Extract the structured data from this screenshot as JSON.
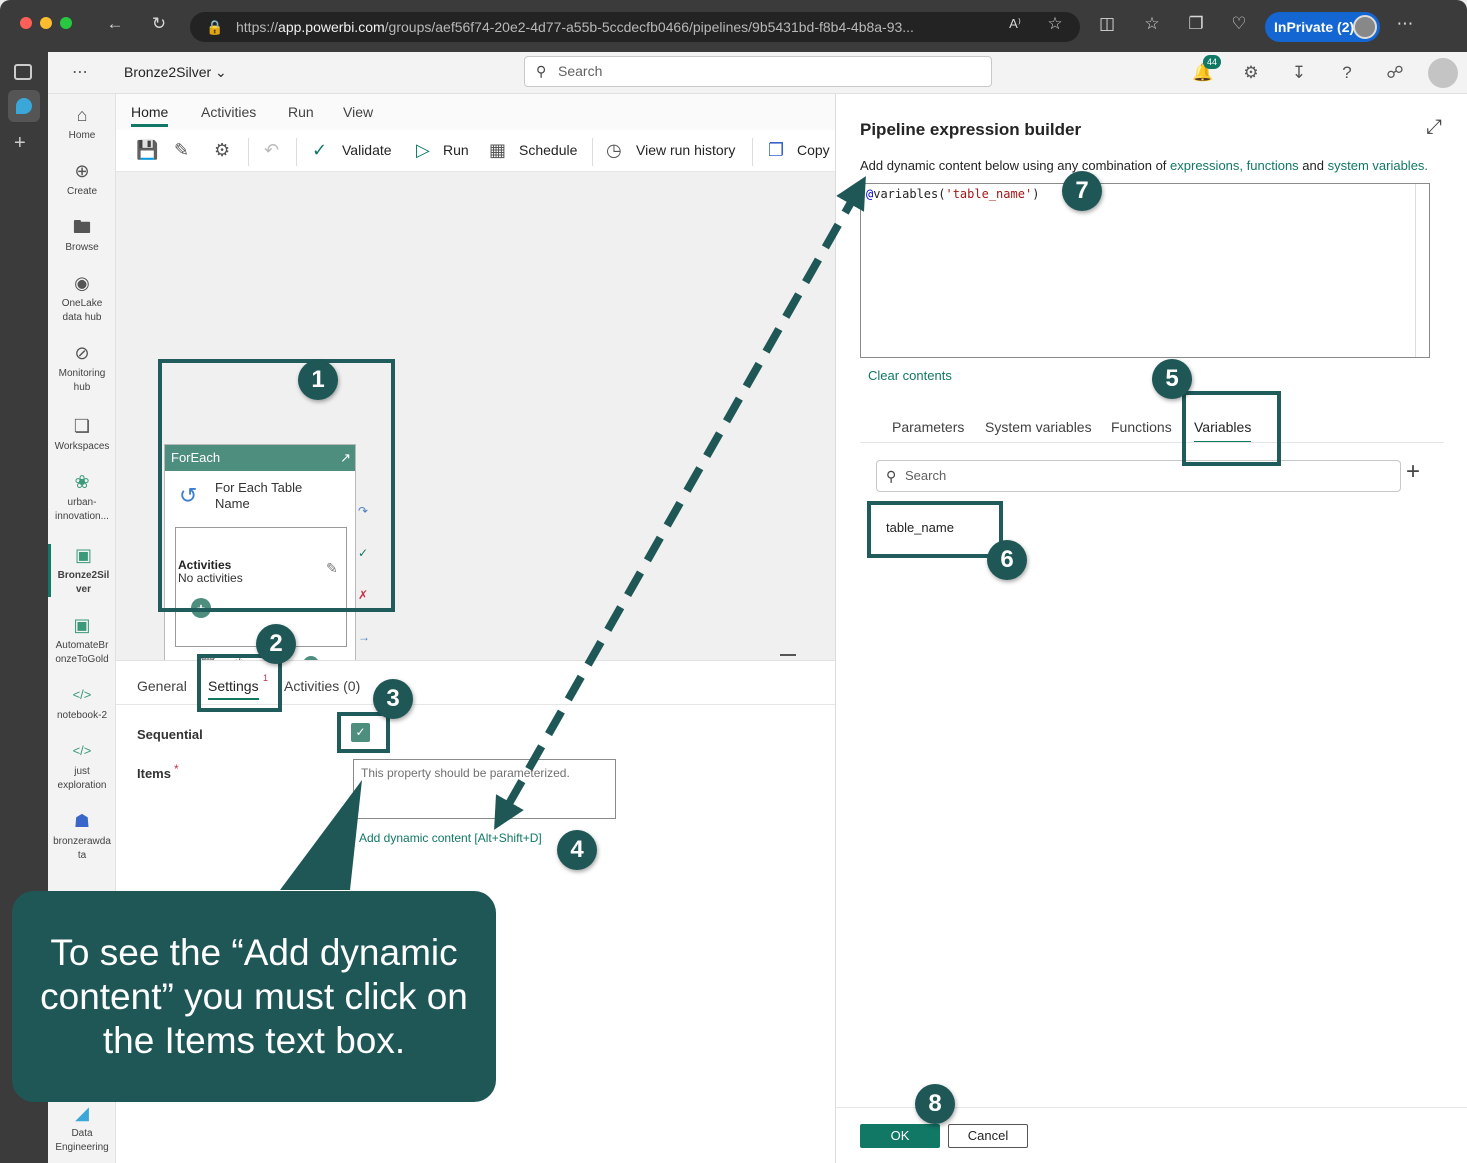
{
  "browser": {
    "url_host": "app.powerbi.com",
    "url_prefix": "https://",
    "url_path": "/groups/aef56f74-20e2-4d77-a55b-5ccdecfb0466/pipelines/9b5431bd-f8b4-4b8a-93...",
    "inprivate_label": "InPrivate (2)"
  },
  "topbar": {
    "workspace": "Bronze2Silver",
    "search_placeholder": "Search",
    "notification_count": "44"
  },
  "leftnav": {
    "items": [
      {
        "label": "Home",
        "icon": "home-icon"
      },
      {
        "label": "Create",
        "icon": "plus-circle-icon"
      },
      {
        "label": "Browse",
        "icon": "folder-icon"
      },
      {
        "label": "OneLake data hub",
        "icon": "onelake-icon"
      },
      {
        "label": "Monitoring hub",
        "icon": "monitor-icon"
      },
      {
        "label": "Workspaces",
        "icon": "workspaces-icon"
      },
      {
        "label": "urban-innovation...",
        "icon": "group-icon"
      },
      {
        "label": "Bronze2Silver",
        "icon": "pipeline-icon"
      },
      {
        "label": "AutomateBronzeToGold",
        "icon": "pipeline-icon"
      },
      {
        "label": "notebook-2",
        "icon": "notebook-icon"
      },
      {
        "label": "just exploration",
        "icon": "notebook-icon"
      },
      {
        "label": "bronzerawdata",
        "icon": "lakehouse-icon"
      },
      {
        "label": "Data Engineering",
        "icon": "data-engineering-icon"
      }
    ]
  },
  "menu": {
    "tabs": [
      "Home",
      "Activities",
      "Run",
      "View"
    ],
    "selected": "Home"
  },
  "ribbon": {
    "validate": "Validate",
    "run": "Run",
    "schedule": "Schedule",
    "view_run_history": "View run history",
    "copy": "Copy"
  },
  "foreach": {
    "header": "ForEach",
    "title": "For Each Table Name",
    "activities_label": "Activities",
    "activities_value": "No activities"
  },
  "bottom": {
    "tabs": [
      "General",
      "Settings",
      "Activities (0)"
    ],
    "settings_badge": "1",
    "sequential_label": "Sequential",
    "items_label": "Items",
    "required_mark": "*",
    "items_placeholder": "This property should be parameterized.",
    "dynamic_link": "Add dynamic content [Alt+Shift+D]"
  },
  "panel": {
    "title": "Pipeline expression builder",
    "subtitle_prefix": "Add dynamic content below using any combination of ",
    "link_expressions": "expressions,",
    "link_functions": "functions",
    "and_word": " and ",
    "link_sysvars": "system variables.",
    "expression_at": "@",
    "expression_fn": "variables(",
    "expression_str": "'table_name'",
    "expression_close": ")",
    "clear": "Clear contents",
    "tabs": [
      "Parameters",
      "System variables",
      "Functions",
      "Variables"
    ],
    "selected_tab": "Variables",
    "search_placeholder": "Search",
    "variables": [
      "table_name"
    ],
    "ok": "OK",
    "cancel": "Cancel"
  },
  "annotations": {
    "steps": [
      "1",
      "2",
      "3",
      "4",
      "5",
      "6",
      "7",
      "8"
    ],
    "callout": "To see the “Add dynamic content” you must click on the Items text box."
  },
  "colors": {
    "accent": "#117865",
    "annotation": "#1f5757"
  }
}
